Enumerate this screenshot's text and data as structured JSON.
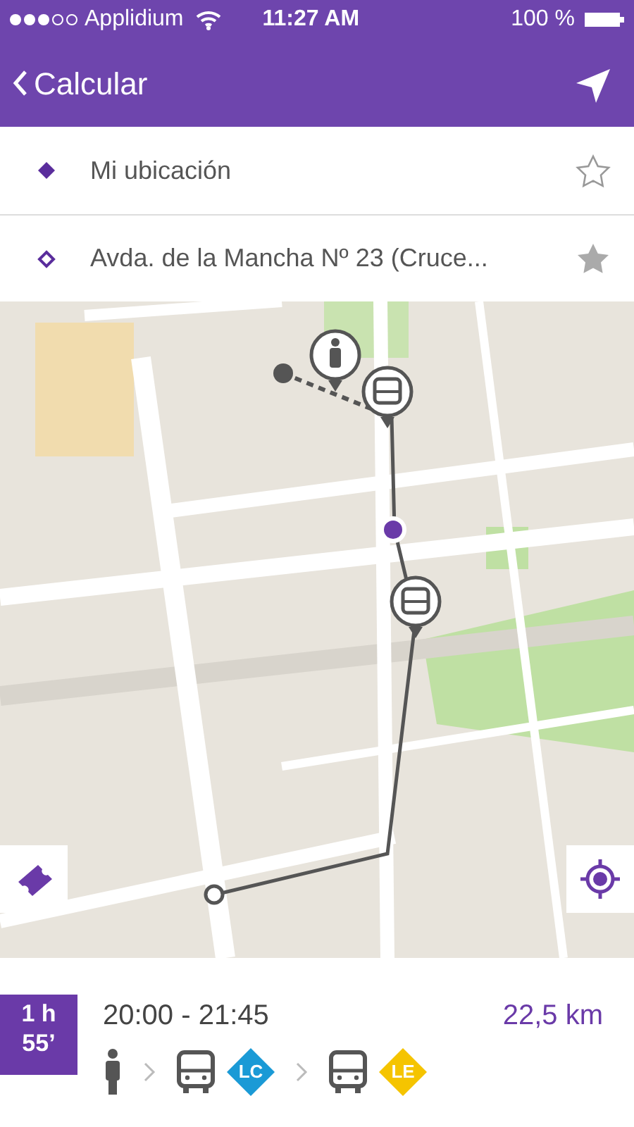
{
  "status_bar": {
    "carrier": "Applidium",
    "time": "11:27 AM",
    "battery": "100 %"
  },
  "nav": {
    "back_label": "Calcular"
  },
  "route_fields": [
    {
      "text": "Mi ubicación",
      "kind": "origin",
      "favorite": false
    },
    {
      "text": "Avda. de la Mancha Nº 23 (Cruce...",
      "kind": "destination",
      "favorite": true
    }
  ],
  "summary": {
    "duration": [
      "1 h",
      "55’"
    ],
    "times": "20:00 - 21:45",
    "distance": "22,5 km",
    "legs": [
      {
        "kind": "walk"
      },
      {
        "kind": "bus",
        "line": "LC",
        "color": "#1a9ad6"
      },
      {
        "kind": "bus",
        "line": "LE",
        "color": "#f5c400"
      }
    ]
  }
}
